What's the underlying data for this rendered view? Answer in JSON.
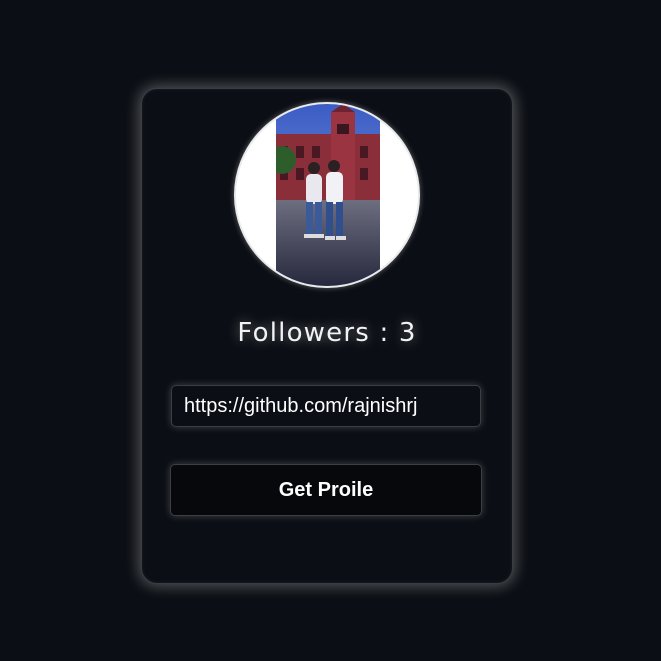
{
  "profile": {
    "avatar_icon": "profile-photo",
    "followers_text": "Followers : 3"
  },
  "form": {
    "url_value": "https://github.com/rajnishrj",
    "submit_label": "Get Proile"
  },
  "colors": {
    "background": "#0b0e14",
    "card_border": "#3a3d44",
    "text": "#ffffff",
    "glow": "#ffffff"
  }
}
